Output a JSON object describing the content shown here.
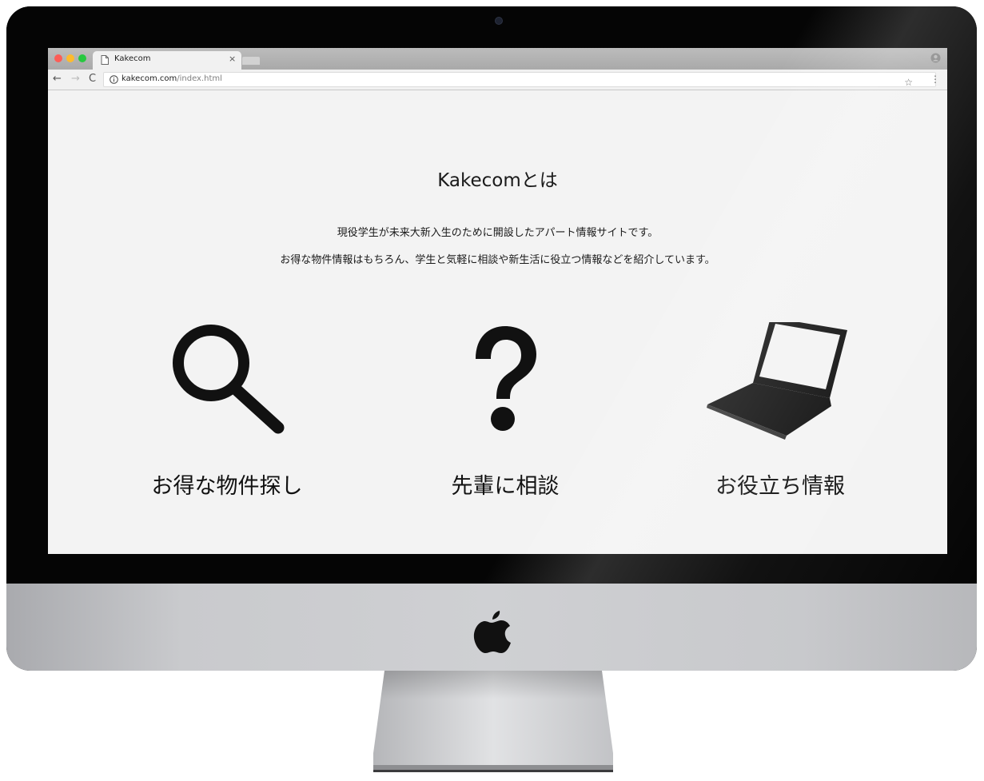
{
  "browser": {
    "tab_title": "Kakecom",
    "tab_close": "×",
    "url_host": "kakecom.com",
    "url_path": "/index.html",
    "nav": {
      "back": "←",
      "forward": "→",
      "reload": "C"
    },
    "star": "☆",
    "menu": "⋮"
  },
  "page": {
    "title": "Kakecomとは",
    "description_1": "現役学生が未来大新入生のために開設したアパート情報サイトです。",
    "description_2": "お得な物件情報はもちろん、学生と気軽に相談や新生活に役立つ情報などを紹介しています。",
    "features": [
      {
        "label": "お得な物件探し",
        "icon": "search-icon"
      },
      {
        "label": "先輩に相談",
        "icon": "question-icon"
      },
      {
        "label": "お役立ち情報",
        "icon": "laptop-icon"
      }
    ]
  },
  "colors": {
    "page_background": "#f3f3f3",
    "text": "#1a1a1a",
    "icon": "#111111"
  }
}
